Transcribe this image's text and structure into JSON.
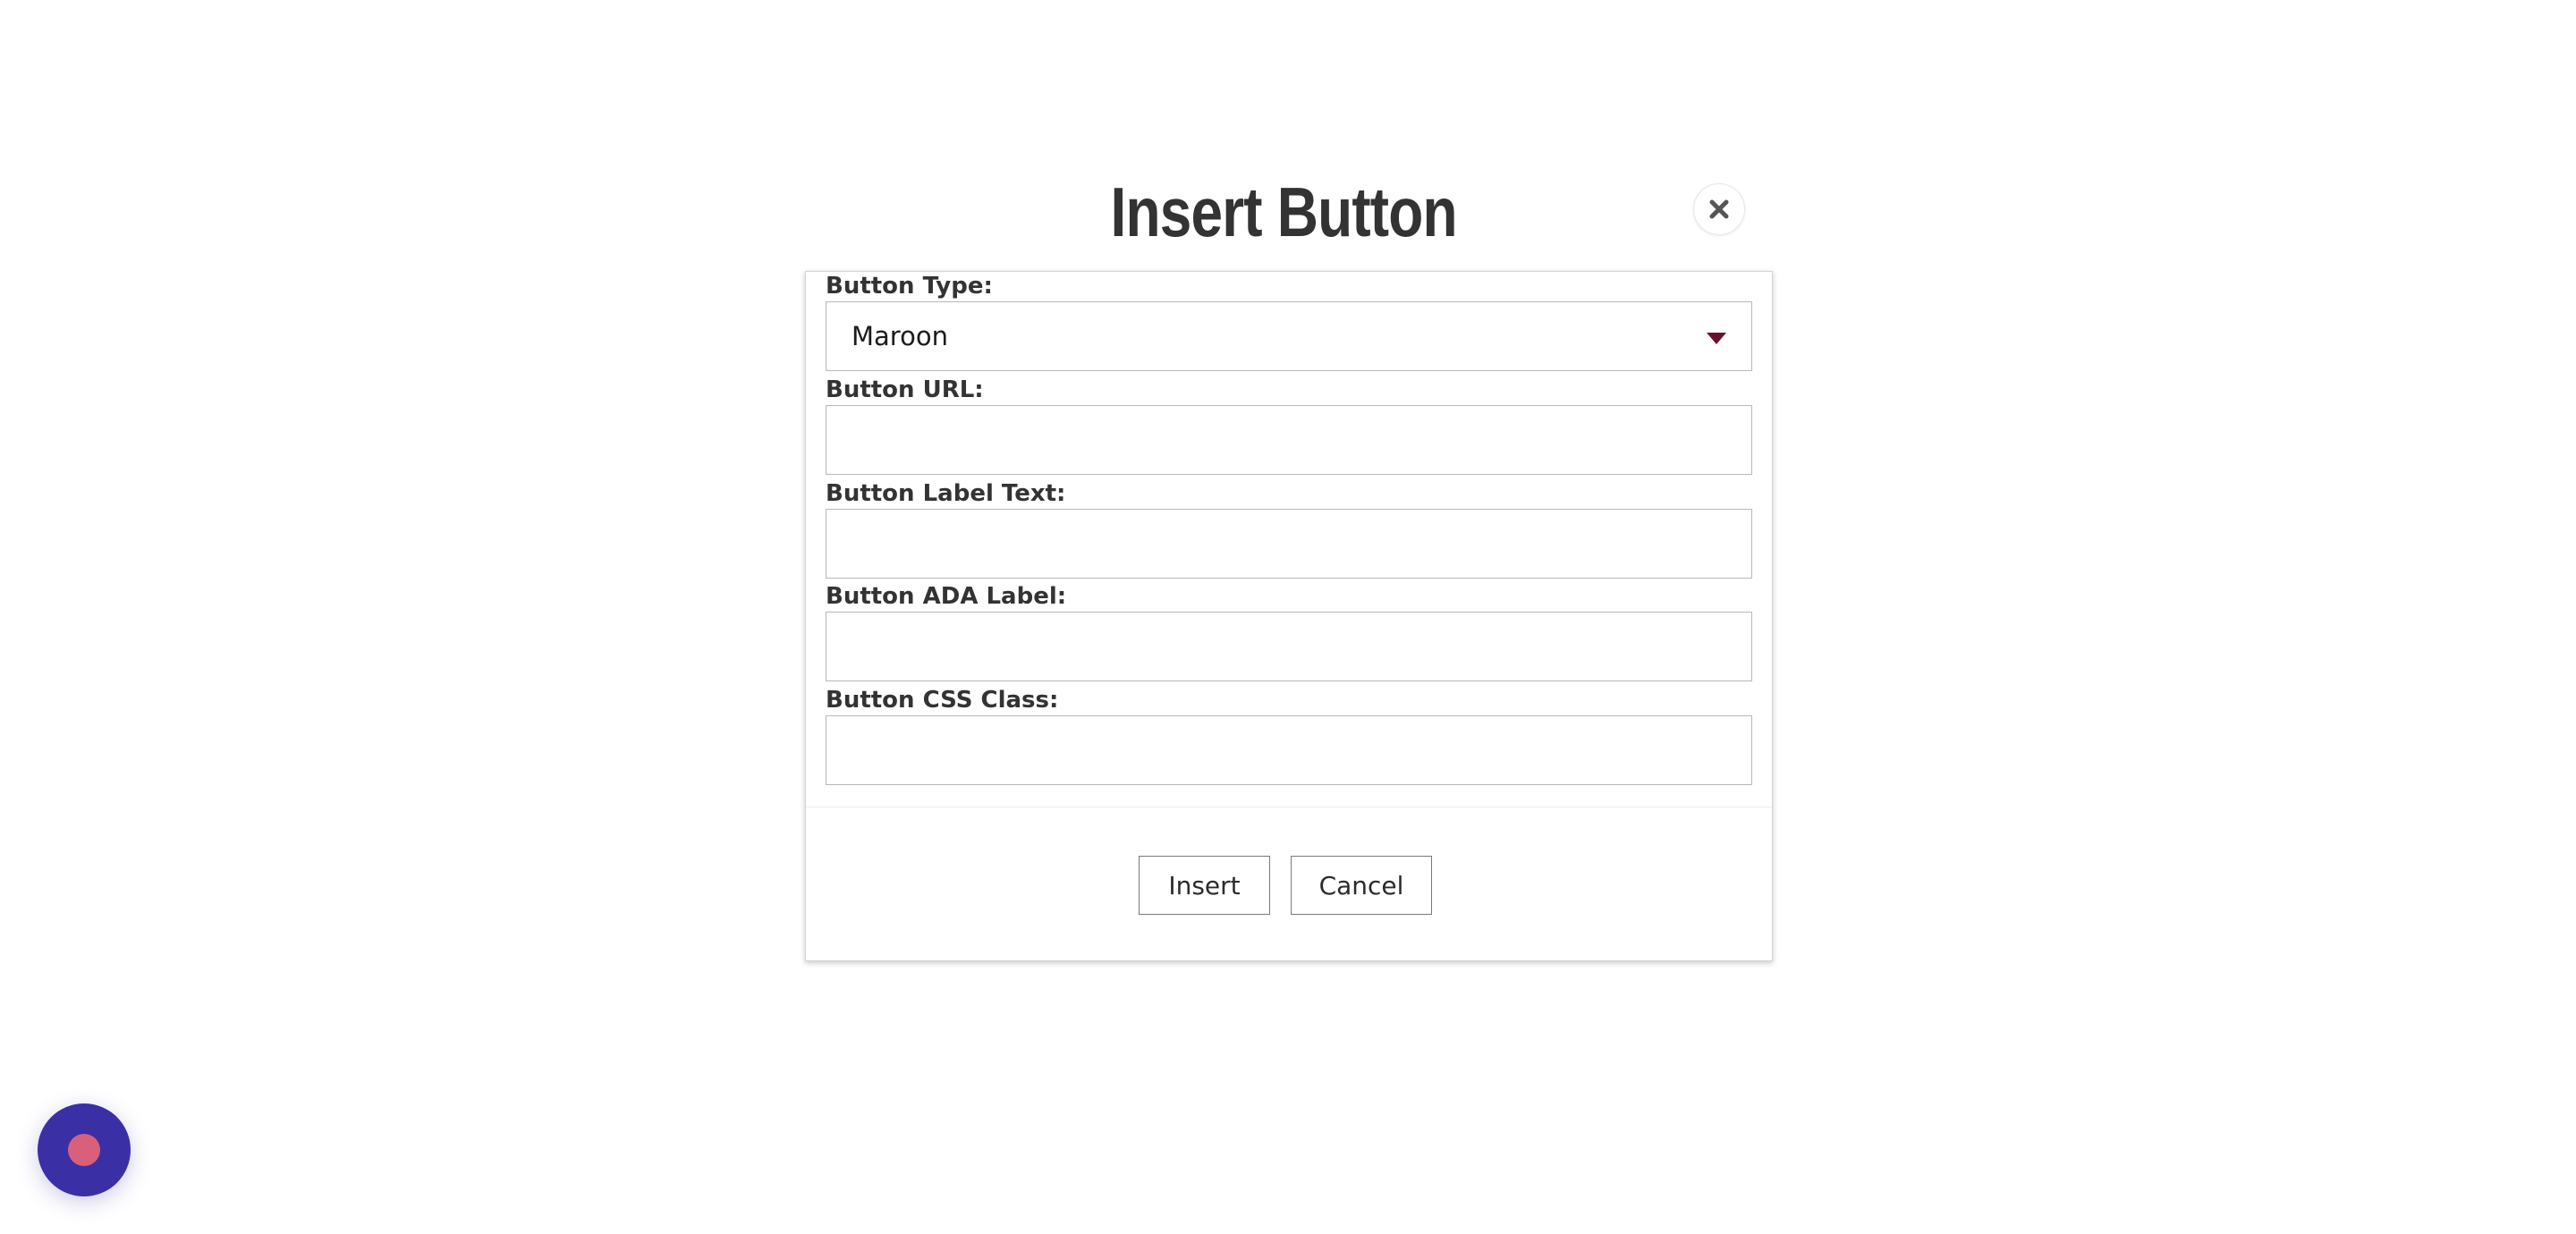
{
  "dialog": {
    "title": "Insert Button",
    "close_icon": "close-icon"
  },
  "form": {
    "button_type": {
      "label": "Button Type:",
      "selected": "Maroon",
      "arrow_color": "#6b0f2a"
    },
    "button_url": {
      "label": "Button URL:",
      "value": ""
    },
    "button_label_text": {
      "label": "Button Label Text:",
      "value": ""
    },
    "button_ada_label": {
      "label": "Button ADA Label:",
      "value": ""
    },
    "button_css_class": {
      "label": "Button CSS Class:",
      "value": ""
    }
  },
  "actions": {
    "insert_label": "Insert",
    "cancel_label": "Cancel"
  },
  "chat_launcher": {
    "icon": "chat-icon",
    "color": "#3b2fa6",
    "dot_color": "#d9607a"
  }
}
